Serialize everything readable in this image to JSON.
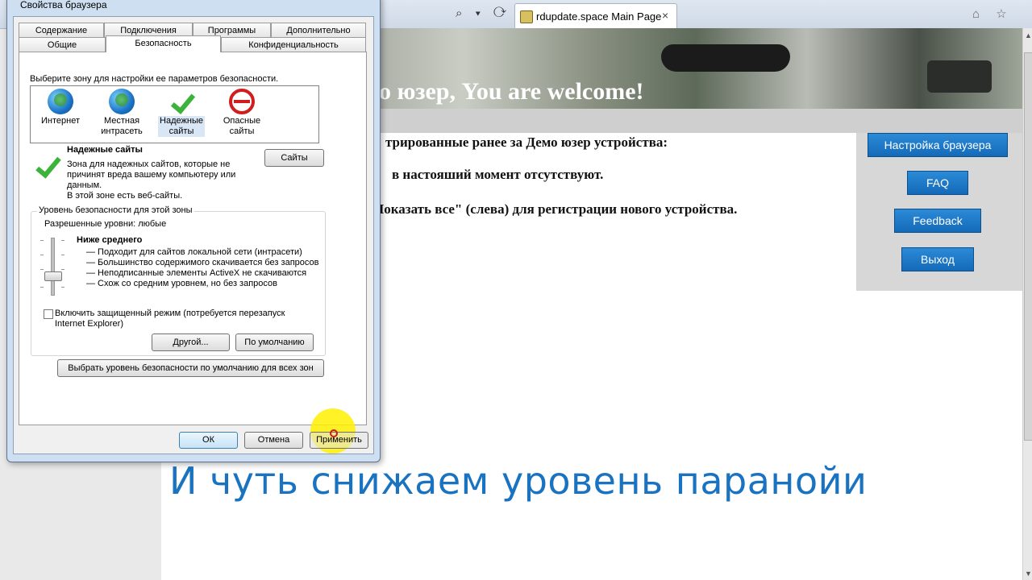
{
  "browser": {
    "tab_title": "rdupdate.space Main Page",
    "tab_close": "×",
    "addr_tools": "⌕ ▾ ⟳",
    "right_tools": "⌂ ☆"
  },
  "page": {
    "banner_text": "о юзер, You are welcome!",
    "line1": "трированные ранее за Демо юзер устройства:",
    "line2": "в настояший момент отсутствуют.",
    "line3": "Показать все\" (слева) для регистрации нового устройства.",
    "buttons": {
      "settings": "Настройка браузера",
      "faq": "FAQ",
      "feedback": "Feedback",
      "exit": "Выход"
    }
  },
  "caption": "И чуть снижаем уровень паранойи",
  "dialog": {
    "title": "Свойства браузера",
    "tabs_row1": [
      "Содержание",
      "Подключения",
      "Программы",
      "Дополнительно"
    ],
    "tabs_row2": [
      "Общие",
      "Безопасность",
      "Конфиденциальность"
    ],
    "zone_prompt": "Выберите зону для настройки ее параметров безопасности.",
    "zones": [
      {
        "line1": "Интернет",
        "line2": ""
      },
      {
        "line1": "Местная",
        "line2": "интрасеть"
      },
      {
        "line1": "Надежные",
        "line2": "сайты"
      },
      {
        "line1": "Опасные",
        "line2": "сайты"
      }
    ],
    "zone_title": "Надежные сайты",
    "zone_desc1": "Зона для надежных сайтов, которые не",
    "zone_desc2": "причинят вреда вашему компьютеру или",
    "zone_desc3": "данным.",
    "zone_desc4": "В этой зоне есть веб-сайты.",
    "sites_button": "Сайты",
    "level_group_title": "Уровень безопасности для этой зоны",
    "allowed_levels": "Разрешенные уровни: любые",
    "level_name": "Ниже среднего",
    "level_items": [
      "— Подходит для сайтов локальной сети (интрасети)",
      "— Большинство содержимого скачивается без запросов",
      "— Неподписанные элементы ActiveX не скачиваются",
      "— Схож со средним уровнем, но без запросов"
    ],
    "protected_mode_line1": "Включить защищенный режим (потребуется перезапуск",
    "protected_mode_line2": "Internet Explorer)",
    "custom_button": "Другой...",
    "default_button": "По умолчанию",
    "reset_all_button": "Выбрать уровень безопасности по умолчанию для всех зон",
    "ok_button": "ОК",
    "cancel_button": "Отмена",
    "apply_button": "Применить"
  }
}
